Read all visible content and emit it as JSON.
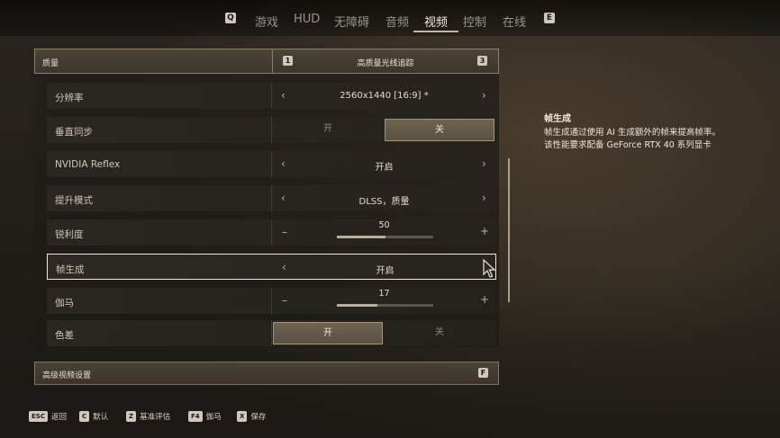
{
  "nav": {
    "left_key": "Q",
    "right_key": "E",
    "tabs": [
      {
        "label": "游戏"
      },
      {
        "label": "HUD"
      },
      {
        "label": "无障碍"
      },
      {
        "label": "音频"
      },
      {
        "label": "视频"
      },
      {
        "label": "控制"
      },
      {
        "label": "在线"
      }
    ],
    "active_tab": "视频"
  },
  "quality": {
    "label": "质量",
    "key_left": "1",
    "key_right": "3",
    "value": "高质量光线追踪"
  },
  "settings": [
    {
      "label": "分辨率",
      "type": "selector",
      "value": "2560x1440 [16:9] *"
    },
    {
      "label": "垂直同步",
      "type": "toggle",
      "on_label": "开",
      "off_label": "关",
      "selected": "关"
    },
    {
      "label": "NVIDIA Reflex",
      "type": "selector",
      "value": "开启"
    },
    {
      "label": "提升模式",
      "type": "selector",
      "value": "DLSS，质量"
    },
    {
      "label": "锐利度",
      "type": "slider",
      "value": "50",
      "fraction": 0.5
    },
    {
      "label": "帧生成",
      "type": "selector",
      "value": "开启",
      "selected": true
    },
    {
      "label": "伽马",
      "type": "slider",
      "value": "17",
      "fraction": 0.42
    },
    {
      "label": "色差",
      "type": "toggle",
      "on_label": "开",
      "off_label": "关",
      "selected": "开"
    }
  ],
  "advanced": {
    "label": "高级视频设置",
    "key": "F"
  },
  "description": {
    "title": "帧生成",
    "lines": [
      "帧生成通过使用 AI 生成额外的帧来提高帧率。",
      "该性能要求配备 GeForce RTX 40 系列显卡"
    ]
  },
  "footer": [
    {
      "key": "ESC",
      "label": "返回"
    },
    {
      "key": "C",
      "label": "默认"
    },
    {
      "key": "Z",
      "label": "基准评估"
    },
    {
      "key": "F4",
      "label": "伽马"
    },
    {
      "key": "X",
      "label": "保存"
    }
  ],
  "icons": {
    "arrow_left": "chevron-left-icon",
    "arrow_right": "chevron-right-icon",
    "minus": "minus-icon",
    "plus": "plus-icon",
    "cursor": "mouse-cursor-icon"
  },
  "colors": {
    "accent": "#a49679",
    "selected_border": "#efe9dc",
    "text": "#e3dccd"
  }
}
